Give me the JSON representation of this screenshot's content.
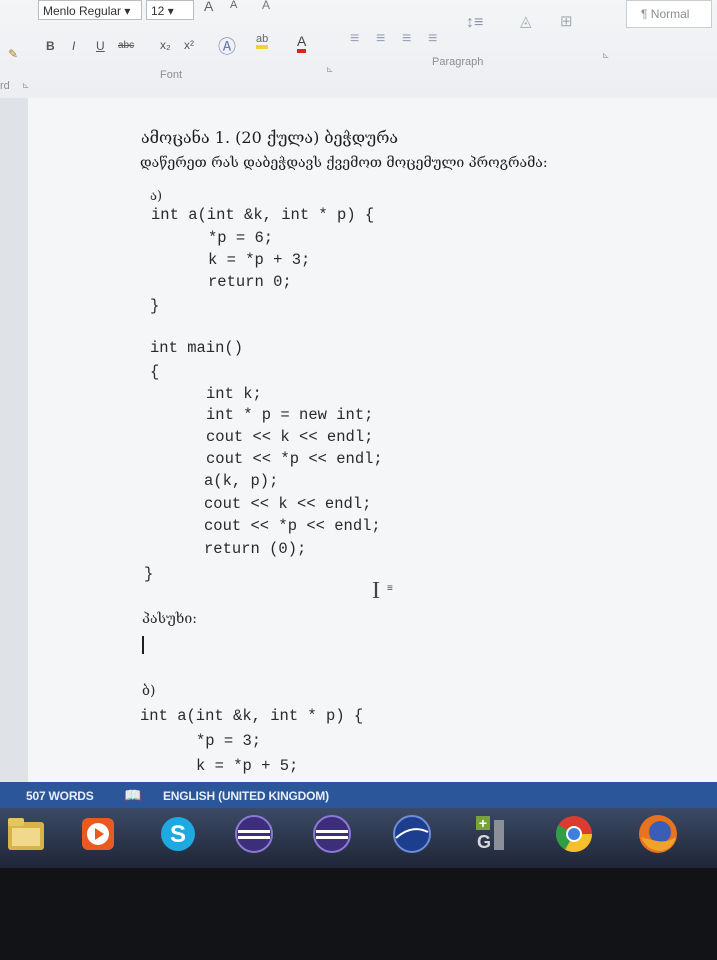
{
  "ribbon": {
    "font_name": "Menlo Regular",
    "font_size": "12",
    "font_group_label": "Font",
    "paragraph_group_label": "Paragraph",
    "style_label": "¶ Normal",
    "bold": "B",
    "italic": "I",
    "underline": "U",
    "strike": "abc",
    "subscript": "x₂",
    "superscript": "x²",
    "clear_format": "A",
    "grow_font": "A",
    "shrink_font": "A",
    "left_label": "rd"
  },
  "document": {
    "heading": "ამოცანა 1. (20 ქულა) ბეჭდურა",
    "instruction": "დაწერეთ რას დაბეჭდავს ქვემოთ მოცემული პროგრამა:",
    "label_a": "ა)",
    "code_a": [
      "int a(int &k, int * p) {",
      "*p = 6;",
      "k = *p + 3;",
      "return 0;",
      "}",
      "int main()",
      "{",
      "int k;",
      "int * p = new int;",
      "cout << k << endl;",
      "cout << *p << endl;",
      "a(k, p);",
      "cout << k << endl;",
      "cout << *p << endl;",
      "return (0);",
      "}"
    ],
    "answer_label": "პასუხი:",
    "label_b": "ბ)",
    "code_b": [
      "int a(int &k, int * p) {",
      "*p = 3;",
      "k = *p + 5;"
    ]
  },
  "statusbar": {
    "words": "507 WORDS",
    "language": "ENGLISH (UNITED KINGDOM)"
  },
  "taskbar": {
    "icons": [
      "file-explorer-icon",
      "media-player-icon",
      "skype-icon",
      "eclipse-icon",
      "eclipse-icon",
      "netbeans-icon",
      "google-plus-icon",
      "chrome-icon",
      "firefox-icon"
    ]
  }
}
